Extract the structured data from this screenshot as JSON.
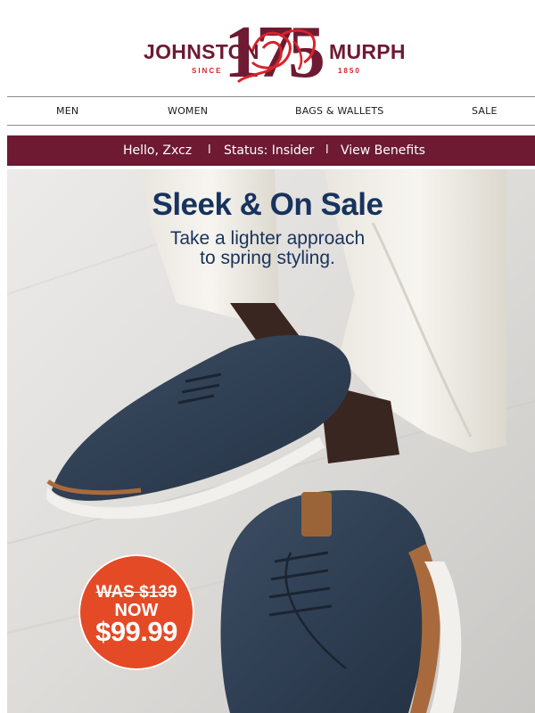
{
  "brand": {
    "left_word": "JOHNSTON",
    "right_word": "MURPHY",
    "left_sub": "SINCE",
    "right_sub": "1850",
    "anniversary": "175",
    "monogram": "J&M",
    "colors": {
      "maroon": "#6d1a32",
      "red": "#d8232a",
      "navy": "#17335e"
    }
  },
  "nav": {
    "items": [
      {
        "label": "MEN"
      },
      {
        "label": "WOMEN"
      },
      {
        "label": "BAGS & WALLETS"
      },
      {
        "label": "SALE"
      }
    ]
  },
  "member_bar": {
    "greeting": "Hello, Zxcz",
    "separator": "l",
    "status": "Status: Insider",
    "benefits_link": "View Benefits"
  },
  "hero": {
    "headline": "Sleek & On Sale",
    "subhead_line1": "Take a lighter approach",
    "subhead_line2": "to spring styling.",
    "image_icon": "navy-suede-derby-shoes-photo"
  },
  "price_badge": {
    "was": "WAS $139",
    "now": "NOW",
    "price": "$99.99",
    "color": "#e44a26"
  }
}
